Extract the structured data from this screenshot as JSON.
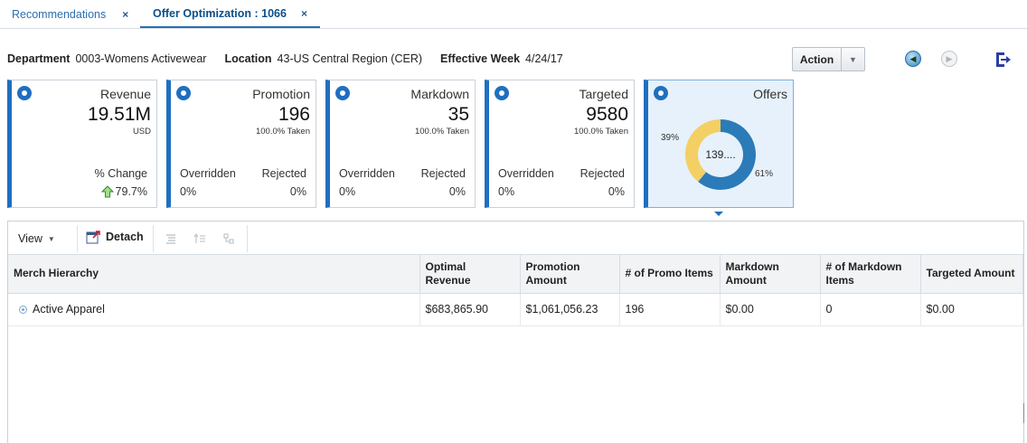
{
  "tabs": [
    {
      "label": "Recommendations",
      "close": "×"
    },
    {
      "label": "Offer Optimization : 1066",
      "close": "×"
    }
  ],
  "context": {
    "department_label": "Department",
    "department_value": "0003-Womens Activewear",
    "location_label": "Location",
    "location_value": "43-US Central Region (CER)",
    "week_label": "Effective Week",
    "week_value": "4/24/17"
  },
  "action": {
    "label": "Action"
  },
  "tiles": {
    "revenue": {
      "title": "Revenue",
      "value": "19.51M",
      "unit": "USD",
      "change_label": "% Change",
      "change_value": "79.7%"
    },
    "promotion": {
      "title": "Promotion",
      "value": "196",
      "taken": "100.0% Taken",
      "overridden_label": "Overridden",
      "rejected_label": "Rejected",
      "overridden_value": "0%",
      "rejected_value": "0%"
    },
    "markdown": {
      "title": "Markdown",
      "value": "35",
      "taken": "100.0% Taken",
      "overridden_label": "Overridden",
      "rejected_label": "Rejected",
      "overridden_value": "0%",
      "rejected_value": "0%"
    },
    "targeted": {
      "title": "Targeted",
      "value": "9580",
      "taken": "100.0% Taken",
      "overridden_label": "Overridden",
      "rejected_label": "Rejected",
      "overridden_value": "0%",
      "rejected_value": "0%"
    },
    "offers": {
      "title": "Offers",
      "center_label": "139....",
      "left_pct": "39%",
      "right_pct": "61%"
    }
  },
  "chart_data": {
    "type": "pie",
    "categories": [
      "",
      ""
    ],
    "values": [
      61,
      39
    ],
    "colors": [
      "#2b7bb9",
      "#f4cf63"
    ]
  },
  "toolbar": {
    "view_label": "View",
    "detach_label": "Detach"
  },
  "table": {
    "headers": [
      "Merch Hierarchy",
      "Optimal Revenue",
      "Promotion Amount",
      "# of Promo Items",
      "Markdown Amount",
      "# of Markdown Items",
      "Targeted Amount"
    ],
    "rows": [
      [
        "Active Apparel",
        "$683,865.90",
        "$1,061,056.23",
        "196",
        "$0.00",
        "0",
        "$0.00"
      ]
    ]
  }
}
